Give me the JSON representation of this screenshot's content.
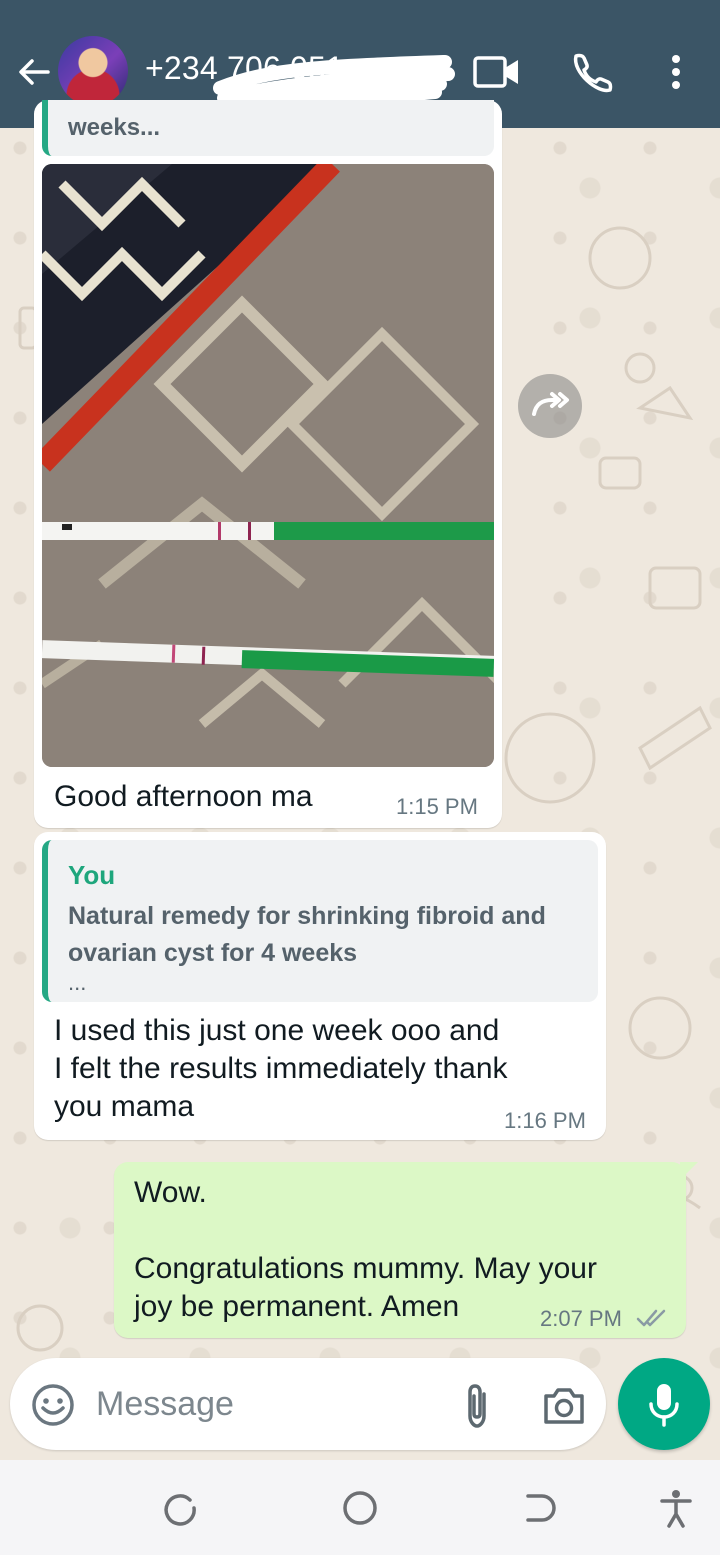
{
  "header": {
    "contact_name": "+234 706 051",
    "colors": {
      "background": "#3b5566"
    },
    "icons": [
      "back-arrow-icon",
      "video-call-icon",
      "phone-icon",
      "more-options-icon"
    ]
  },
  "messages": [
    {
      "direction": "incoming",
      "quoted_fragment": "weeks...",
      "has_image": true,
      "text": "Good afternoon ma",
      "time": "1:15 PM"
    },
    {
      "direction": "incoming",
      "quote": {
        "author": "You",
        "text": "Natural remedy for shrinking fibroid and ovarian cyst for  4 weeks",
        "ellipsis": "..."
      },
      "text_lines": [
        "I used this just one week ooo and",
        "I felt the results immediately thank",
        "you mama"
      ],
      "time": "1:16 PM"
    },
    {
      "direction": "outgoing",
      "text_lines": [
        "Wow.",
        "",
        "Congratulations mummy.  May your",
        "joy be permanent. Amen"
      ],
      "time": "2:07 PM",
      "status": "read"
    }
  ],
  "composer": {
    "placeholder": "Message",
    "icons": [
      "emoji-icon",
      "attach-icon",
      "camera-icon",
      "mic-icon"
    ]
  },
  "colors": {
    "accent": "#00a884",
    "outgoing_bubble": "#dcf8c6",
    "incoming_bubble": "#ffffff",
    "quote_author": "#1ea67c"
  }
}
